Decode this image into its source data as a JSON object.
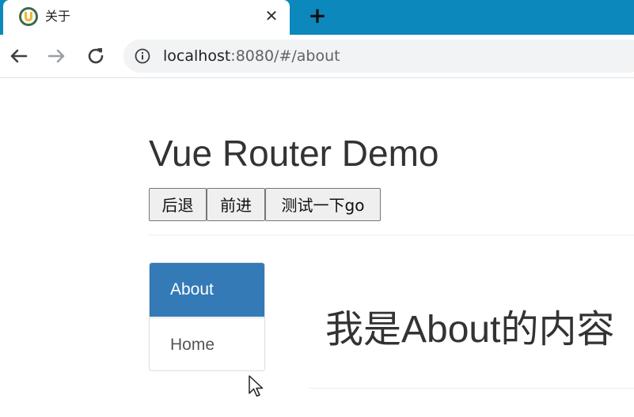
{
  "browser": {
    "tab": {
      "title": "关于",
      "favicon": "vue-router-favicon-icon",
      "close_glyph": "✕"
    },
    "new_tab_glyph": "+",
    "address": {
      "host": "localhost",
      "path": ":8080/#/about"
    },
    "colors": {
      "tab_strip": "#0c88bd",
      "omnibox_bg": "#f1f3f4"
    }
  },
  "page": {
    "title": "Vue Router Demo",
    "buttons": {
      "back": "后退",
      "forward": "前进",
      "go": "测试一下go"
    },
    "nav": {
      "items": [
        {
          "label": "About",
          "active": true
        },
        {
          "label": "Home",
          "active": false
        }
      ],
      "active_color": "#337ab7"
    },
    "content": {
      "heading": "我是About的内容"
    }
  }
}
